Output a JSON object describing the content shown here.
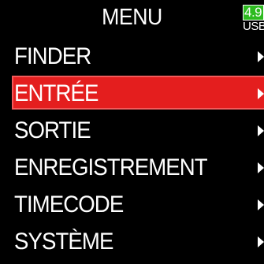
{
  "header": {
    "title": "MENU",
    "battery": {
      "value": "4.9",
      "source": "USB",
      "color": "#2dbb1f"
    }
  },
  "menu": {
    "selected_color": "#e41e1e",
    "items": [
      {
        "label": "FINDER",
        "selected": false,
        "arrow": "chevron-right-icon"
      },
      {
        "label": "ENTRÉE",
        "selected": true,
        "arrow": "chevron-right-icon"
      },
      {
        "label": "SORTIE",
        "selected": false,
        "arrow": "chevron-right-icon"
      },
      {
        "label": "ENREGISTREMENT",
        "selected": false,
        "arrow": "chevron-right-icon"
      },
      {
        "label": "TIMECODE",
        "selected": false,
        "arrow": "chevron-right-icon"
      },
      {
        "label": "SYSTÈME",
        "selected": false,
        "arrow": "chevron-right-icon"
      }
    ]
  }
}
